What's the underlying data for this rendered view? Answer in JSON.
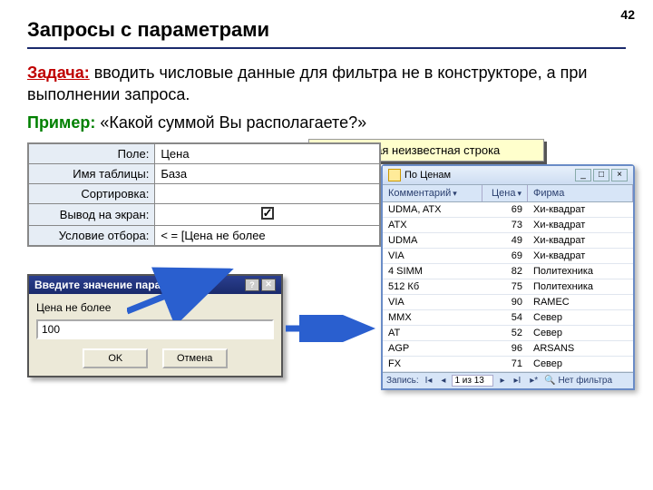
{
  "page_number": "42",
  "title": "Запросы с параметрами",
  "task_label": "Задача:",
  "task_text": " вводить числовые данные для фильтра не в конструкторе, а при выполнении запроса.",
  "example_label": "Пример:",
  "example_text": " «Какой суммой Вы располагаете?»",
  "yellow_note": "Любая неизвестная строка",
  "design_grid": {
    "rows": [
      {
        "label": "Поле:",
        "value": "Цена"
      },
      {
        "label": "Имя таблицы:",
        "value": "База"
      },
      {
        "label": "Сортировка:",
        "value": ""
      },
      {
        "label": "Вывод на экран:",
        "value": "checkbox"
      },
      {
        "label": "Условие отбора:",
        "value": "< = [Цена не более"
      }
    ]
  },
  "param_dialog": {
    "title": "Введите значение параметра",
    "label": "Цена не более",
    "value": "100",
    "ok": "OK",
    "cancel": "Отмена"
  },
  "result": {
    "title": "По Ценам",
    "headers": [
      "Комментарий",
      "Цена",
      "Фирма"
    ],
    "rows": [
      [
        "UDMA, ATX",
        "69",
        "Хи-квадрат"
      ],
      [
        "ATX",
        "73",
        "Хи-квадрат"
      ],
      [
        "UDMA",
        "49",
        "Хи-квадрат"
      ],
      [
        "VIA",
        "69",
        "Хи-квадрат"
      ],
      [
        "4 SIMM",
        "82",
        "Политехника"
      ],
      [
        "512 Кб",
        "75",
        "Политехника"
      ],
      [
        "VIA",
        "90",
        "RAMEC"
      ],
      [
        "MMX",
        "54",
        "Север"
      ],
      [
        "AT",
        "52",
        "Север"
      ],
      [
        "AGP",
        "96",
        "ARSANS"
      ],
      [
        "FX",
        "71",
        "Север"
      ]
    ],
    "footer": {
      "label": "Запись:",
      "position": "1 из 13",
      "filter": "Нет фильтра"
    }
  }
}
